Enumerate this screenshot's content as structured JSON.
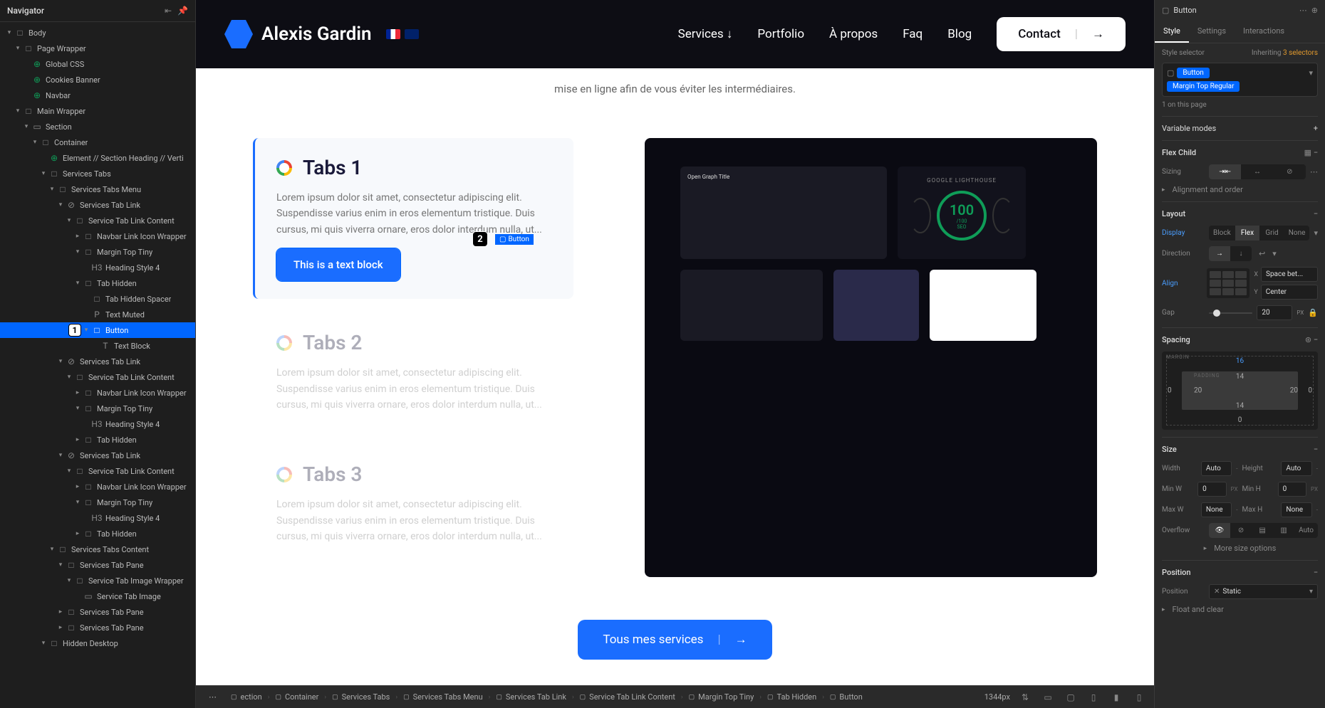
{
  "navigator": {
    "title": "Navigator",
    "tree": [
      {
        "indent": 0,
        "caret": "▾",
        "icon": "□",
        "label": "Body"
      },
      {
        "indent": 1,
        "caret": "▾",
        "icon": "□",
        "label": "Page Wrapper"
      },
      {
        "indent": 2,
        "caret": "",
        "icon": "⊕",
        "label": "Global CSS",
        "green": true
      },
      {
        "indent": 2,
        "caret": "",
        "icon": "⊕",
        "label": "Cookies Banner",
        "green": true
      },
      {
        "indent": 2,
        "caret": "",
        "icon": "⊕",
        "label": "Navbar",
        "green": true
      },
      {
        "indent": 1,
        "caret": "▾",
        "icon": "□",
        "label": "Main Wrapper"
      },
      {
        "indent": 2,
        "caret": "▾",
        "icon": "▭",
        "label": "Section"
      },
      {
        "indent": 3,
        "caret": "▾",
        "icon": "□",
        "label": "Container"
      },
      {
        "indent": 4,
        "caret": "",
        "icon": "⊕",
        "label": "Element // Section Heading // Verti",
        "green": true
      },
      {
        "indent": 4,
        "caret": "▾",
        "icon": "□",
        "label": "Services Tabs"
      },
      {
        "indent": 5,
        "caret": "▾",
        "icon": "□",
        "label": "Services Tabs Menu"
      },
      {
        "indent": 6,
        "caret": "▾",
        "icon": "⊘",
        "label": "Services Tab Link"
      },
      {
        "indent": 7,
        "caret": "▾",
        "icon": "□",
        "label": "Service Tab Link Content"
      },
      {
        "indent": 8,
        "caret": "▸",
        "icon": "□",
        "label": "Navbar Link Icon Wrapper"
      },
      {
        "indent": 8,
        "caret": "▾",
        "icon": "□",
        "label": "Margin Top Tiny"
      },
      {
        "indent": 9,
        "caret": "",
        "icon": "H3",
        "label": "Heading Style 4"
      },
      {
        "indent": 8,
        "caret": "▾",
        "icon": "□",
        "label": "Tab Hidden"
      },
      {
        "indent": 9,
        "caret": "",
        "icon": "□",
        "label": "Tab Hidden Spacer"
      },
      {
        "indent": 9,
        "caret": "",
        "icon": "P",
        "label": "Text Muted"
      },
      {
        "indent": 9,
        "caret": "▾",
        "icon": "□",
        "label": "Button",
        "selected": true,
        "badge": "1"
      },
      {
        "indent": 10,
        "caret": "",
        "icon": "T",
        "label": "Text Block"
      },
      {
        "indent": 6,
        "caret": "▾",
        "icon": "⊘",
        "label": "Services Tab Link"
      },
      {
        "indent": 7,
        "caret": "▾",
        "icon": "□",
        "label": "Service Tab Link Content"
      },
      {
        "indent": 8,
        "caret": "▸",
        "icon": "□",
        "label": "Navbar Link Icon Wrapper"
      },
      {
        "indent": 8,
        "caret": "▾",
        "icon": "□",
        "label": "Margin Top Tiny"
      },
      {
        "indent": 9,
        "caret": "",
        "icon": "H3",
        "label": "Heading Style 4"
      },
      {
        "indent": 8,
        "caret": "▸",
        "icon": "□",
        "label": "Tab Hidden"
      },
      {
        "indent": 6,
        "caret": "▾",
        "icon": "⊘",
        "label": "Services Tab Link"
      },
      {
        "indent": 7,
        "caret": "▾",
        "icon": "□",
        "label": "Service Tab Link Content"
      },
      {
        "indent": 8,
        "caret": "▸",
        "icon": "□",
        "label": "Navbar Link Icon Wrapper"
      },
      {
        "indent": 8,
        "caret": "▾",
        "icon": "□",
        "label": "Margin Top Tiny"
      },
      {
        "indent": 9,
        "caret": "",
        "icon": "H3",
        "label": "Heading Style 4"
      },
      {
        "indent": 8,
        "caret": "▸",
        "icon": "□",
        "label": "Tab Hidden"
      },
      {
        "indent": 5,
        "caret": "▾",
        "icon": "□",
        "label": "Services Tabs Content"
      },
      {
        "indent": 6,
        "caret": "▾",
        "icon": "□",
        "label": "Services Tab Pane"
      },
      {
        "indent": 7,
        "caret": "▾",
        "icon": "□",
        "label": "Service Tab Image Wrapper"
      },
      {
        "indent": 8,
        "caret": "",
        "icon": "▭",
        "label": "Service Tab Image"
      },
      {
        "indent": 6,
        "caret": "▸",
        "icon": "□",
        "label": "Services Tab Pane"
      },
      {
        "indent": 6,
        "caret": "▸",
        "icon": "□",
        "label": "Services Tab Pane"
      },
      {
        "indent": 4,
        "caret": "▾",
        "icon": "□",
        "label": "Hidden Desktop"
      }
    ]
  },
  "site": {
    "logo": "Alexis Gardin",
    "nav": [
      "Services",
      "Portfolio",
      "À propos",
      "Faq",
      "Blog"
    ],
    "contact": "Contact",
    "subtitle": "mise en ligne afin de vous éviter les intermédiaires.",
    "tabs": [
      {
        "title": "Tabs 1",
        "desc": "Lorem ipsum dolor sit amet, consectetur adipiscing elit. Suspendisse varius enim in eros elementum tristique. Duis cursus, mi quis viverra ornare, eros dolor interdum nulla, ut..."
      },
      {
        "title": "Tabs 2",
        "desc": "Lorem ipsum dolor sit amet, consectetur adipiscing elit. Suspendisse varius enim in eros elementum tristique. Duis cursus, mi quis viverra ornare, eros dolor interdum nulla, ut..."
      },
      {
        "title": "Tabs 3",
        "desc": "Lorem ipsum dolor sit amet, consectetur adipiscing elit. Suspendisse varius enim in eros elementum tristique. Duis cursus, mi quis viverra ornare, eros dolor interdum nulla, ut..."
      }
    ],
    "selection_label": "Button",
    "selection_badge": "2",
    "text_block": "This is a text block",
    "cta": "Tous mes services",
    "lighthouse": {
      "title": "GOOGLE LIGHTHOUSE",
      "score": "100",
      "sub": "/100",
      "label": "SEO"
    },
    "og_title": "Open Graph Title"
  },
  "breadcrumb": {
    "items": [
      "ection",
      "Container",
      "Services Tabs",
      "Services Tabs Menu",
      "Services Tab Link",
      "Service Tab Link Content",
      "Margin Top Tiny",
      "Tab Hidden",
      "Button"
    ],
    "zoom": "1344px"
  },
  "style_panel": {
    "element": "Button",
    "tabs": [
      "Style",
      "Settings",
      "Interactions"
    ],
    "selector_label": "Style selector",
    "inheriting": "Inheriting",
    "inheriting_count": "3 selectors",
    "chip1": "Button",
    "chip2": "Margin Top Regular",
    "on_page": "1 on this page",
    "var_modes": "Variable modes",
    "flex_child": {
      "title": "Flex Child",
      "sizing": "Sizing",
      "align_order": "Alignment and order"
    },
    "layout": {
      "title": "Layout",
      "display": "Display",
      "display_opts": [
        "Block",
        "Flex",
        "Grid",
        "None"
      ],
      "direction": "Direction",
      "align": "Align",
      "x_label": "X",
      "x_val": "Space bet...",
      "y_label": "Y",
      "y_val": "Center",
      "gap": "Gap",
      "gap_val": "20",
      "gap_unit": "PX"
    },
    "spacing": {
      "title": "Spacing",
      "margin_label": "MARGIN",
      "padding_label": "PADDING",
      "m_top": "16",
      "m_right": "0",
      "m_bottom": "0",
      "m_left": "0",
      "p_top": "14",
      "p_right": "20",
      "p_bottom": "14",
      "p_left": "20"
    },
    "size": {
      "title": "Size",
      "width": "Width",
      "width_val": "Auto",
      "height": "Height",
      "height_val": "Auto",
      "minw": "Min W",
      "minw_val": "0",
      "minw_unit": "PX",
      "minh": "Min H",
      "minh_val": "0",
      "minh_unit": "PX",
      "maxw": "Max W",
      "maxw_val": "None",
      "maxh": "Max H",
      "maxh_val": "None",
      "overflow": "Overflow",
      "more": "More size options"
    },
    "position": {
      "title": "Position",
      "label": "Position",
      "val": "Static",
      "float": "Float and clear"
    }
  }
}
